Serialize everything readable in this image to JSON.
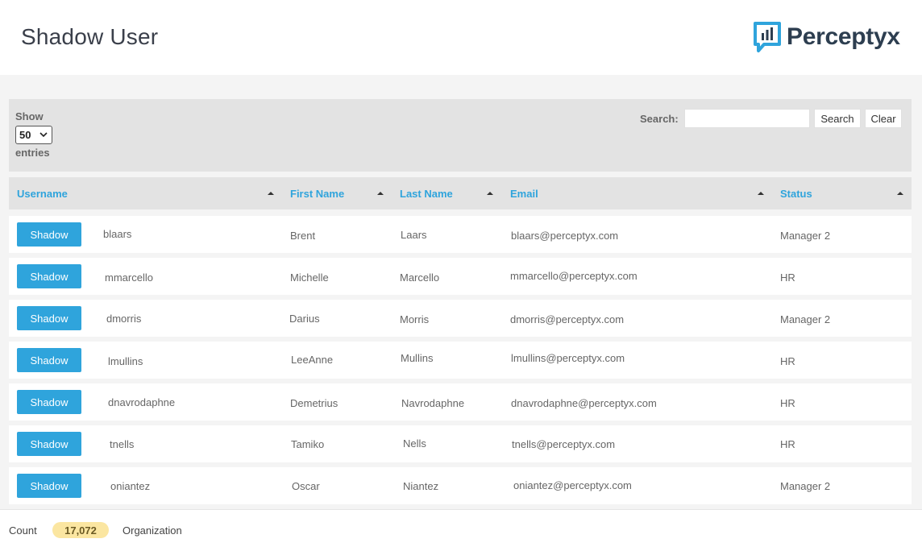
{
  "header": {
    "title": "Shadow User",
    "logo_text": "Perceptyx",
    "brand_color": "#2fa4dc"
  },
  "controls": {
    "show_label": "Show",
    "page_size": "50",
    "entries_label": "entries",
    "search_label": "Search:",
    "search_value": "",
    "search_placeholder": "",
    "search_button": "Search",
    "clear_button": "Clear"
  },
  "table": {
    "columns": [
      "Username",
      "First Name",
      "Last Name",
      "Email",
      "Status"
    ],
    "action_label": "Shadow",
    "rows": [
      {
        "username": "blaars",
        "first_name": "Brent",
        "last_name": "Laars",
        "email": "blaars@perceptyx.com",
        "status": "Manager 2"
      },
      {
        "username": "mmarcello",
        "first_name": "Michelle",
        "last_name": "Marcello",
        "email": "mmarcello@perceptyx.com",
        "status": "HR"
      },
      {
        "username": "dmorris",
        "first_name": "Darius",
        "last_name": "Morris",
        "email": "dmorris@perceptyx.com",
        "status": "Manager 2"
      },
      {
        "username": "lmullins",
        "first_name": "LeeAnne",
        "last_name": "Mullins",
        "email": "lmullins@perceptyx.com",
        "status": "HR"
      },
      {
        "username": "dnavrodaphne",
        "first_name": "Demetrius",
        "last_name": "Navrodaphne",
        "email": "dnavrodaphne@perceptyx.com",
        "status": "HR"
      },
      {
        "username": "tnells",
        "first_name": "Tamiko",
        "last_name": "Nells",
        "email": "tnells@perceptyx.com",
        "status": "HR"
      },
      {
        "username": "oniantez",
        "first_name": "Oscar",
        "last_name": "Niantez",
        "email": "oniantez@perceptyx.com",
        "status": "Manager 2"
      }
    ]
  },
  "footer": {
    "count_label": "Count",
    "count_value": "17,072",
    "org_label": "Organization"
  },
  "icons": {
    "logo": "perceptyx-logo-icon",
    "select": "chevron-down-icon",
    "sort": "sort-asc-icon"
  }
}
